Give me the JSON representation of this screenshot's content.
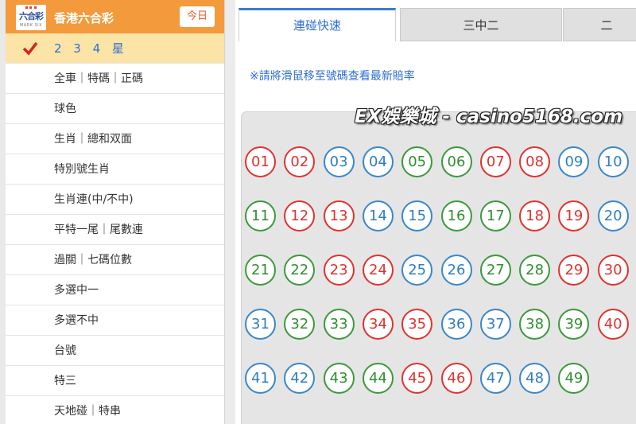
{
  "header": {
    "logo_text": "六合彩",
    "logo_sub": "MARK SIX",
    "title": "香港六合彩",
    "today_button": "今日"
  },
  "sidebar_items": [
    {
      "label": "2 3 4 星",
      "active": true
    },
    {
      "label": "全車｜特碼｜正碼",
      "active": false
    },
    {
      "label": "球色",
      "active": false
    },
    {
      "label": "生肖｜總和双面",
      "active": false
    },
    {
      "label": "特別號生肖",
      "active": false
    },
    {
      "label": "生肖連(中/不中)",
      "active": false
    },
    {
      "label": "平特一尾｜尾數連",
      "active": false
    },
    {
      "label": "過關｜七碼位數",
      "active": false
    },
    {
      "label": "多選中一",
      "active": false
    },
    {
      "label": "多選不中",
      "active": false
    },
    {
      "label": "台號",
      "active": false
    },
    {
      "label": "特三",
      "active": false
    },
    {
      "label": "天地碰｜特串",
      "active": false
    }
  ],
  "tabs": [
    {
      "label": "連碰快速",
      "active": true
    },
    {
      "label": "三中二",
      "active": false
    },
    {
      "label": "二",
      "active": false
    }
  ],
  "notice": "※請將滑鼠移至號碼查看最新賠率",
  "watermark": "EX娛樂城 - casino5168.com",
  "colors": {
    "red": "#e0322f",
    "blue": "#3a87c8",
    "green": "#3a9a3a",
    "header_orange": "#f39a3d",
    "active_row": "#fce3a6"
  },
  "balls": [
    {
      "n": "01",
      "c": "red"
    },
    {
      "n": "02",
      "c": "red"
    },
    {
      "n": "03",
      "c": "blue"
    },
    {
      "n": "04",
      "c": "blue"
    },
    {
      "n": "05",
      "c": "green"
    },
    {
      "n": "06",
      "c": "green"
    },
    {
      "n": "07",
      "c": "red"
    },
    {
      "n": "08",
      "c": "red"
    },
    {
      "n": "09",
      "c": "blue"
    },
    {
      "n": "10",
      "c": "blue"
    },
    {
      "n": "11",
      "c": "green"
    },
    {
      "n": "12",
      "c": "red"
    },
    {
      "n": "13",
      "c": "red"
    },
    {
      "n": "14",
      "c": "blue"
    },
    {
      "n": "15",
      "c": "blue"
    },
    {
      "n": "16",
      "c": "green"
    },
    {
      "n": "17",
      "c": "green"
    },
    {
      "n": "18",
      "c": "red"
    },
    {
      "n": "19",
      "c": "red"
    },
    {
      "n": "20",
      "c": "blue"
    },
    {
      "n": "21",
      "c": "green"
    },
    {
      "n": "22",
      "c": "green"
    },
    {
      "n": "23",
      "c": "red"
    },
    {
      "n": "24",
      "c": "red"
    },
    {
      "n": "25",
      "c": "blue"
    },
    {
      "n": "26",
      "c": "blue"
    },
    {
      "n": "27",
      "c": "green"
    },
    {
      "n": "28",
      "c": "green"
    },
    {
      "n": "29",
      "c": "red"
    },
    {
      "n": "30",
      "c": "red"
    },
    {
      "n": "31",
      "c": "blue"
    },
    {
      "n": "32",
      "c": "green"
    },
    {
      "n": "33",
      "c": "green"
    },
    {
      "n": "34",
      "c": "red"
    },
    {
      "n": "35",
      "c": "red"
    },
    {
      "n": "36",
      "c": "blue"
    },
    {
      "n": "37",
      "c": "blue"
    },
    {
      "n": "38",
      "c": "green"
    },
    {
      "n": "39",
      "c": "green"
    },
    {
      "n": "40",
      "c": "red"
    },
    {
      "n": "41",
      "c": "blue"
    },
    {
      "n": "42",
      "c": "blue"
    },
    {
      "n": "43",
      "c": "green"
    },
    {
      "n": "44",
      "c": "green"
    },
    {
      "n": "45",
      "c": "red"
    },
    {
      "n": "46",
      "c": "red"
    },
    {
      "n": "47",
      "c": "blue"
    },
    {
      "n": "48",
      "c": "blue"
    },
    {
      "n": "49",
      "c": "green"
    }
  ]
}
